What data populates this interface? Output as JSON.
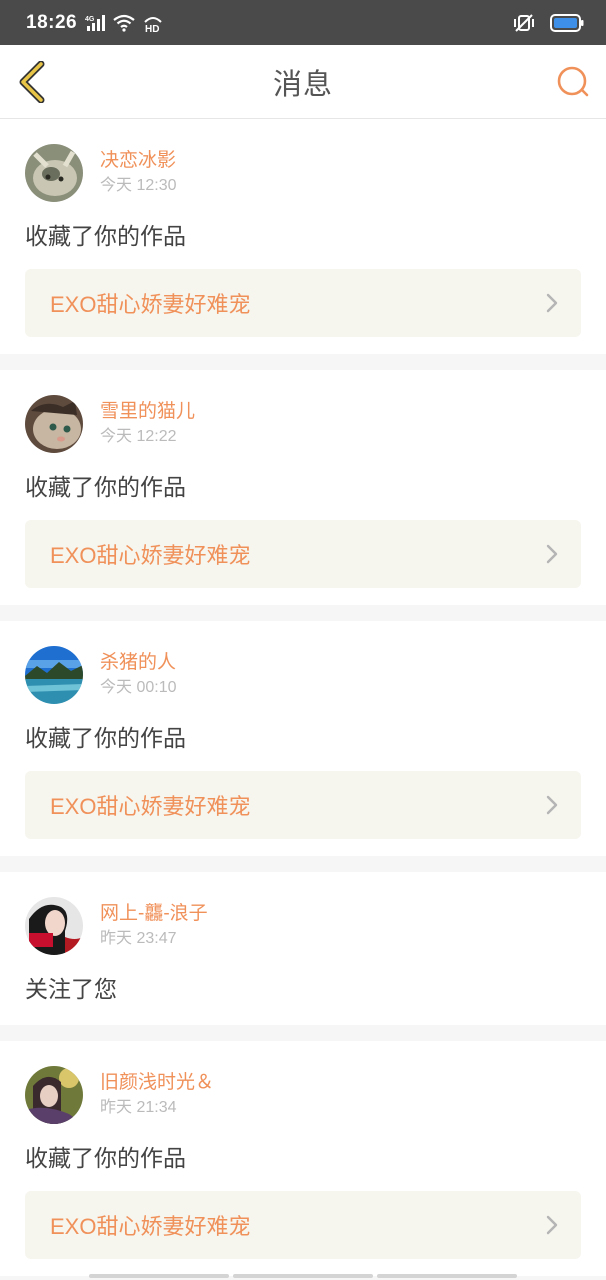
{
  "status_bar": {
    "time": "18:26",
    "network": "4G",
    "hd": "HD"
  },
  "app_bar": {
    "title": "消息"
  },
  "messages": [
    {
      "user": "决恋冰影",
      "time": "今天 12:30",
      "action": "收藏了你的作品",
      "work": "EXO甜心娇妻好难宠",
      "avatar": "cat-avatar"
    },
    {
      "user": "雪里的猫儿",
      "time": "今天 12:22",
      "action": "收藏了你的作品",
      "work": "EXO甜心娇妻好难宠",
      "avatar": "cat-avatar"
    },
    {
      "user": "杀猪的人",
      "time": "今天 00:10",
      "action": "收藏了你的作品",
      "work": "EXO甜心娇妻好难宠",
      "avatar": "landscape-avatar"
    },
    {
      "user": "网上-龘-浪子",
      "time": "昨天 23:47",
      "action": "关注了您",
      "avatar": "person-avatar"
    },
    {
      "user": "旧颜浅时光＆",
      "time": "昨天 21:34",
      "action": "收藏了你的作品",
      "work": "EXO甜心娇妻好难宠",
      "avatar": "person-avatar"
    }
  ],
  "colors": {
    "accent": "#f0915a",
    "status_bar": "#4a4a4a",
    "back_icon": "#e8c547"
  }
}
